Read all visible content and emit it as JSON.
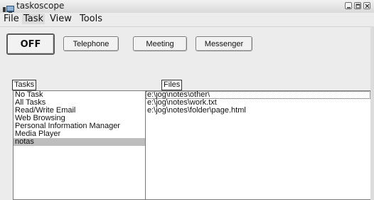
{
  "window": {
    "title": "taskoscope"
  },
  "menu": {
    "items": [
      {
        "label": "File"
      },
      {
        "label": "Task"
      },
      {
        "label": "View"
      },
      {
        "label": "Tools"
      }
    ]
  },
  "toolbar": {
    "off_label": "OFF",
    "telephone_label": "Telephone",
    "meeting_label": "Meeting",
    "messenger_label": "Messenger"
  },
  "tasks": {
    "label": "Tasks",
    "items": [
      "No Task",
      "All Tasks",
      "Read/Write Email",
      "Web Browsing",
      "Personal Information Manager",
      "Media Player",
      "notas"
    ],
    "selected": "notas"
  },
  "files": {
    "label": "Files",
    "items": [
      "e:\\jog\\notes\\other\\",
      "e:\\jog\\notes\\work.txt",
      "e:\\jog\\notes\\folder\\page.html"
    ]
  },
  "colors": {
    "selection": "#bdbdbd",
    "window_bg": "#ececec"
  }
}
